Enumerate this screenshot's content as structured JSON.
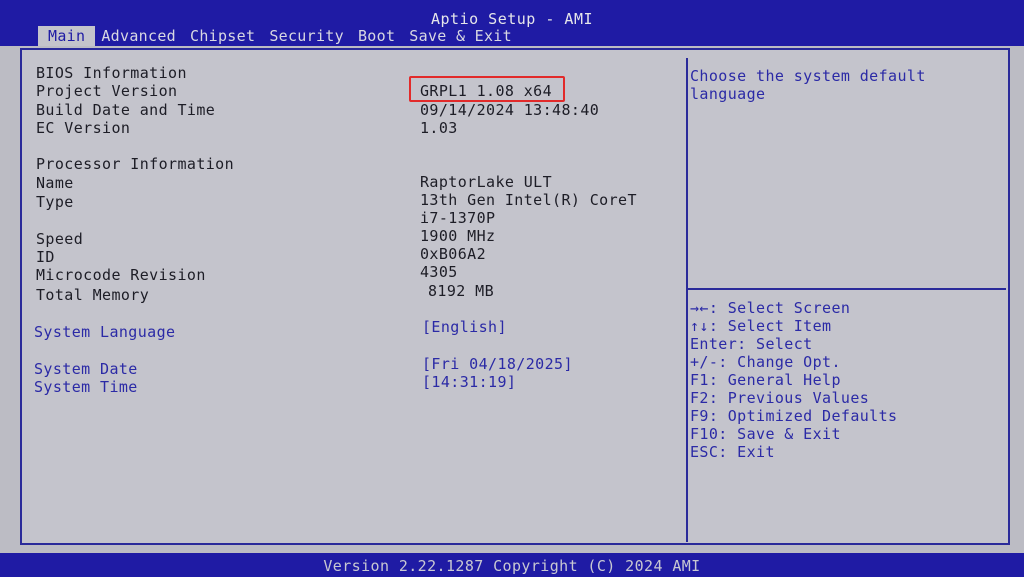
{
  "header": {
    "title": "Aptio Setup - AMI",
    "tabs": [
      {
        "label": "Main",
        "active": true
      },
      {
        "label": "Advanced",
        "active": false
      },
      {
        "label": "Chipset",
        "active": false
      },
      {
        "label": "Security",
        "active": false
      },
      {
        "label": "Boot",
        "active": false
      },
      {
        "label": "Save & Exit",
        "active": false
      }
    ]
  },
  "main": {
    "bios_section": "BIOS Information",
    "project_version_label": "Project Version",
    "project_version_value": "GRPL1 1.08 x64",
    "build_date_label": "Build Date and Time",
    "build_date_value": "09/14/2024 13:48:40",
    "ec_version_label": "EC Version",
    "ec_version_value": "1.03",
    "processor_section": "Processor Information",
    "name_label": "Name",
    "name_value": "RaptorLake ULT",
    "type_label": "Type",
    "type_value_line1": "13th Gen Intel(R) CoreT",
    "type_value_line2": "i7-1370P",
    "speed_label": "Speed",
    "speed_value": "1900 MHz",
    "id_label": "ID",
    "id_value": "0xB06A2",
    "microcode_label": "Microcode Revision",
    "microcode_value": "4305",
    "memory_label": "Total Memory",
    "memory_value": "8192 MB",
    "language_label": "System Language",
    "language_value": "[English]",
    "date_label": "System Date",
    "date_value": "[Fri 04/18/2025]",
    "time_label": "System Time",
    "time_value": "[14:31:19]"
  },
  "help": {
    "description_line1": "Choose the system default",
    "description_line2": "language",
    "keys": [
      "→←: Select Screen",
      "↑↓: Select Item",
      "Enter: Select",
      "+/-: Change Opt.",
      "F1: General Help",
      "F2: Previous Values",
      "F9: Optimized Defaults",
      "F10: Save & Exit",
      "ESC: Exit"
    ]
  },
  "footer": {
    "version": "Version 2.22.1287 Copyright (C) 2024 AMI"
  },
  "colors": {
    "header_blue": "#1f1ba4",
    "panel_gray": "#c4c4cc",
    "selectable_blue": "#2b2aa6",
    "highlight_red": "#e22a2a"
  }
}
